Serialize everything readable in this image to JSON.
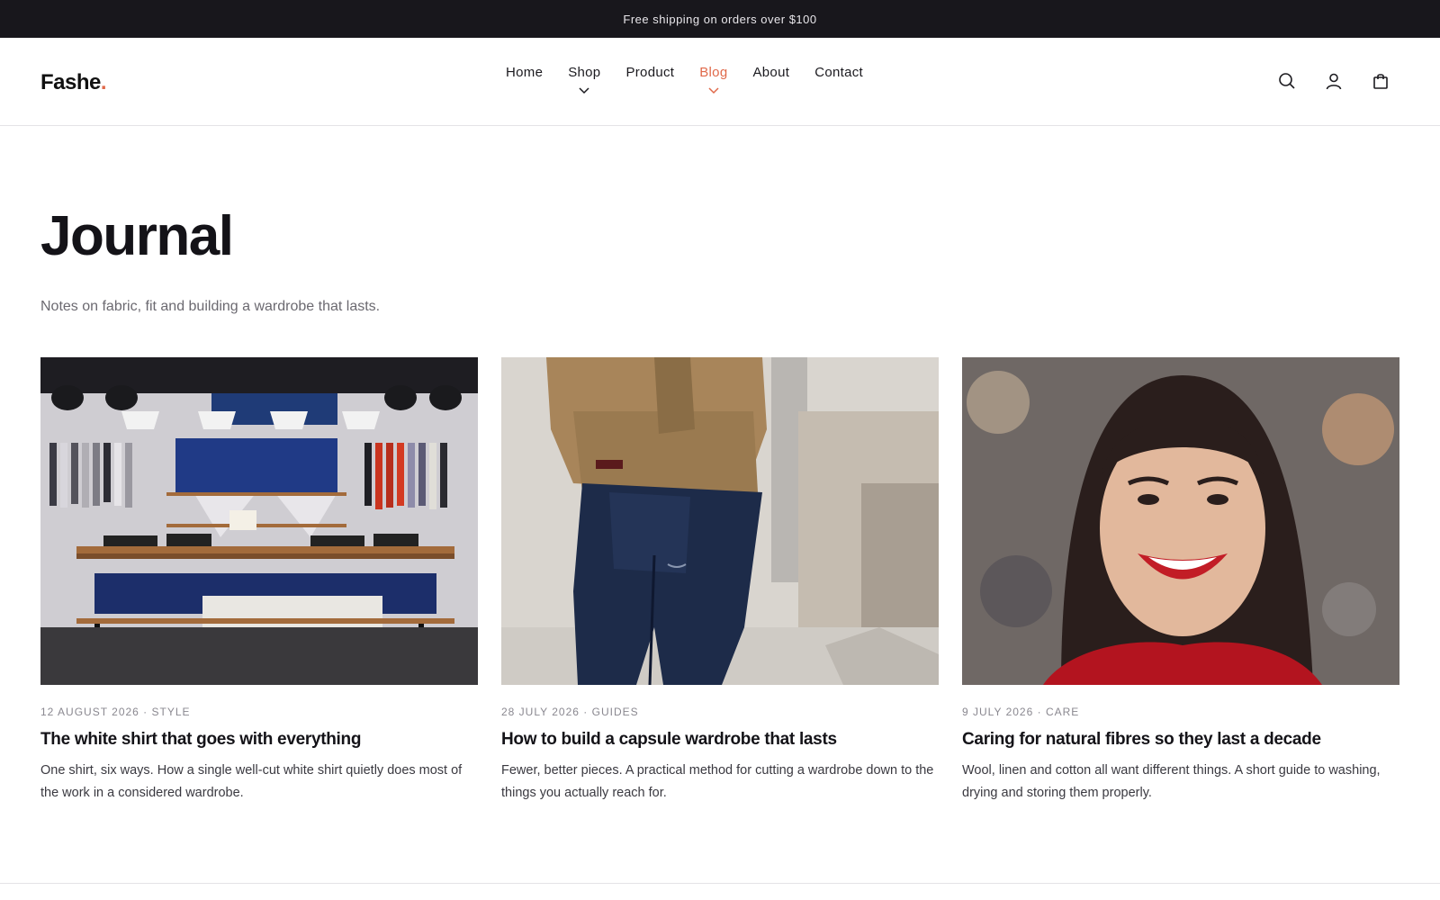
{
  "announcement": "Free shipping on orders over $100",
  "header": {
    "logo_text": "Fashe",
    "logo_dot": ".",
    "nav": [
      {
        "label": "Home",
        "has_dropdown": false,
        "active": false
      },
      {
        "label": "Shop",
        "has_dropdown": true,
        "active": false
      },
      {
        "label": "Product",
        "has_dropdown": false,
        "active": false
      },
      {
        "label": "Blog",
        "has_dropdown": true,
        "active": true
      },
      {
        "label": "About",
        "has_dropdown": false,
        "active": false
      },
      {
        "label": "Contact",
        "has_dropdown": false,
        "active": false
      }
    ],
    "icons": [
      "search-icon",
      "account-icon",
      "shopping-bag-icon"
    ]
  },
  "page": {
    "title": "Journal",
    "subtitle": "Notes on fabric, fit and building a wardrobe that lasts."
  },
  "posts": [
    {
      "meta": "12 August 2026 · Style",
      "title": "The white shirt that goes with everything",
      "excerpt": "One shirt, six ways. How a single well-cut white shirt quietly does most of the work in a considered wardrobe."
    },
    {
      "meta": "28 July 2026 · Guides",
      "title": "How to build a capsule wardrobe that lasts",
      "excerpt": "Fewer, better pieces. A practical method for cutting a wardrobe down to the things you actually reach for."
    },
    {
      "meta": "9 July 2026 · Care",
      "title": "Caring for natural fibres so they last a decade",
      "excerpt": "Wool, linen and cotton all want different things. A short guide to washing, drying and storing them properly."
    }
  ],
  "colors": {
    "accent": "#e0694a",
    "announcement_bg": "#18171c",
    "text": "#1b1a1f",
    "muted": "#6b6970"
  }
}
